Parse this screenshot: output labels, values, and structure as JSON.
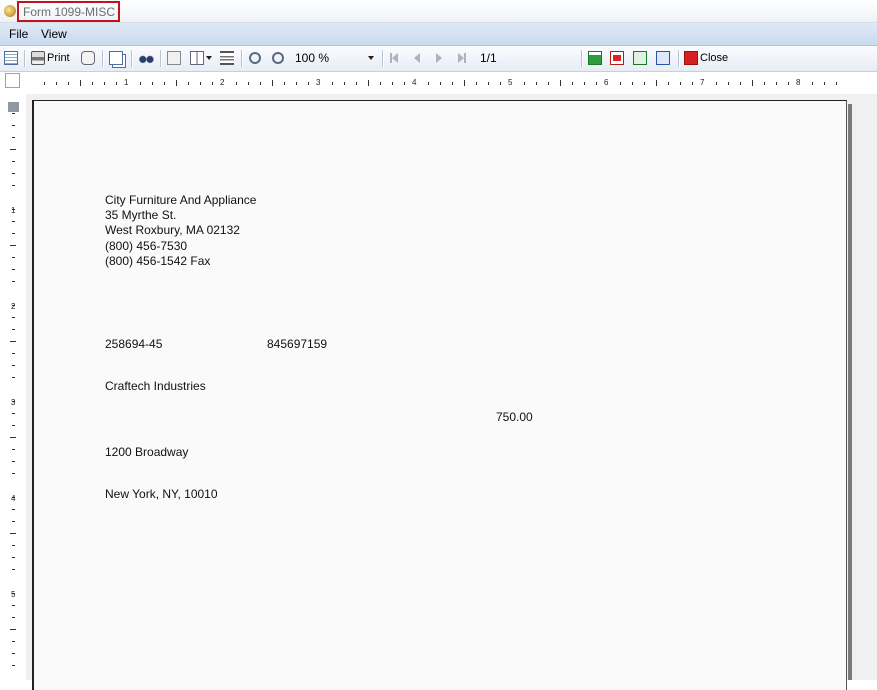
{
  "window": {
    "title": "Form 1099-MISC"
  },
  "menu": {
    "items": [
      "File",
      "View"
    ]
  },
  "toolbar": {
    "print_label": "Print",
    "zoom_value": "100 %",
    "page_indicator": "1/1",
    "close_label": "Close",
    "icons": [
      "page-setup-icon",
      "print-icon",
      "attach-icon",
      "copy-icon",
      "find-icon",
      "single-page-icon",
      "multi-page-icon",
      "continuous-icon",
      "zoom-out-icon",
      "zoom-in-icon",
      "first-page-icon",
      "previous-page-icon",
      "next-page-icon",
      "last-page-icon",
      "export-excel-icon",
      "export-pdf-icon",
      "export-xlsx-icon",
      "export-word-icon",
      "close-icon"
    ]
  },
  "ruler": {
    "horizontal_labels": [
      "1",
      "2",
      "3",
      "4",
      "5",
      "6",
      "7",
      "8"
    ],
    "vertical_labels": [
      "1",
      "2",
      "3",
      "4",
      "5"
    ]
  },
  "document": {
    "payer": {
      "name": "City Furniture And Appliance",
      "street": "35 Myrthe St.",
      "city_state_zip": "West Roxbury,  MA  02132",
      "phone": "(800) 456-7530",
      "fax": "(800) 456-1542 Fax"
    },
    "payer_federal_id": "258694-45",
    "recipient_id": "845697159",
    "recipient_name": "Craftech Industries",
    "amount": "750.00",
    "recipient_street": "1200 Broadway",
    "recipient_city_state_zip": "New York, NY, 10010"
  }
}
